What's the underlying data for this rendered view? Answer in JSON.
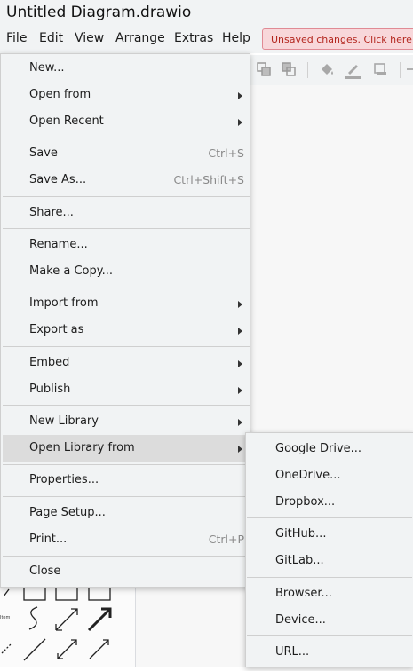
{
  "window": {
    "title": "Untitled Diagram.drawio"
  },
  "menubar": {
    "items": [
      {
        "label": "File"
      },
      {
        "label": "Edit"
      },
      {
        "label": "View"
      },
      {
        "label": "Arrange"
      },
      {
        "label": "Extras"
      },
      {
        "label": "Help"
      }
    ],
    "unsaved_banner": "Unsaved changes. Click here to save."
  },
  "file_menu": {
    "new": "New...",
    "open_from": "Open from",
    "open_recent": "Open Recent",
    "save": "Save",
    "save_shortcut": "Ctrl+S",
    "save_as": "Save As...",
    "save_as_shortcut": "Ctrl+Shift+S",
    "share": "Share...",
    "rename": "Rename...",
    "make_copy": "Make a Copy...",
    "import_from": "Import from",
    "export_as": "Export as",
    "embed": "Embed",
    "publish": "Publish",
    "new_library": "New Library",
    "open_library_from": "Open Library from",
    "properties": "Properties...",
    "page_setup": "Page Setup...",
    "print": "Print...",
    "print_shortcut": "Ctrl+P",
    "close": "Close"
  },
  "library_submenu": {
    "google_drive": "Google Drive...",
    "onedrive": "OneDrive...",
    "dropbox": "Dropbox...",
    "github": "GitHub...",
    "gitlab": "GitLab...",
    "browser": "Browser...",
    "device": "Device...",
    "url": "URL..."
  },
  "colors": {
    "highlight": "#dcdcdc",
    "banner_bg": "#f8d7da",
    "banner_text": "#b3261e"
  }
}
